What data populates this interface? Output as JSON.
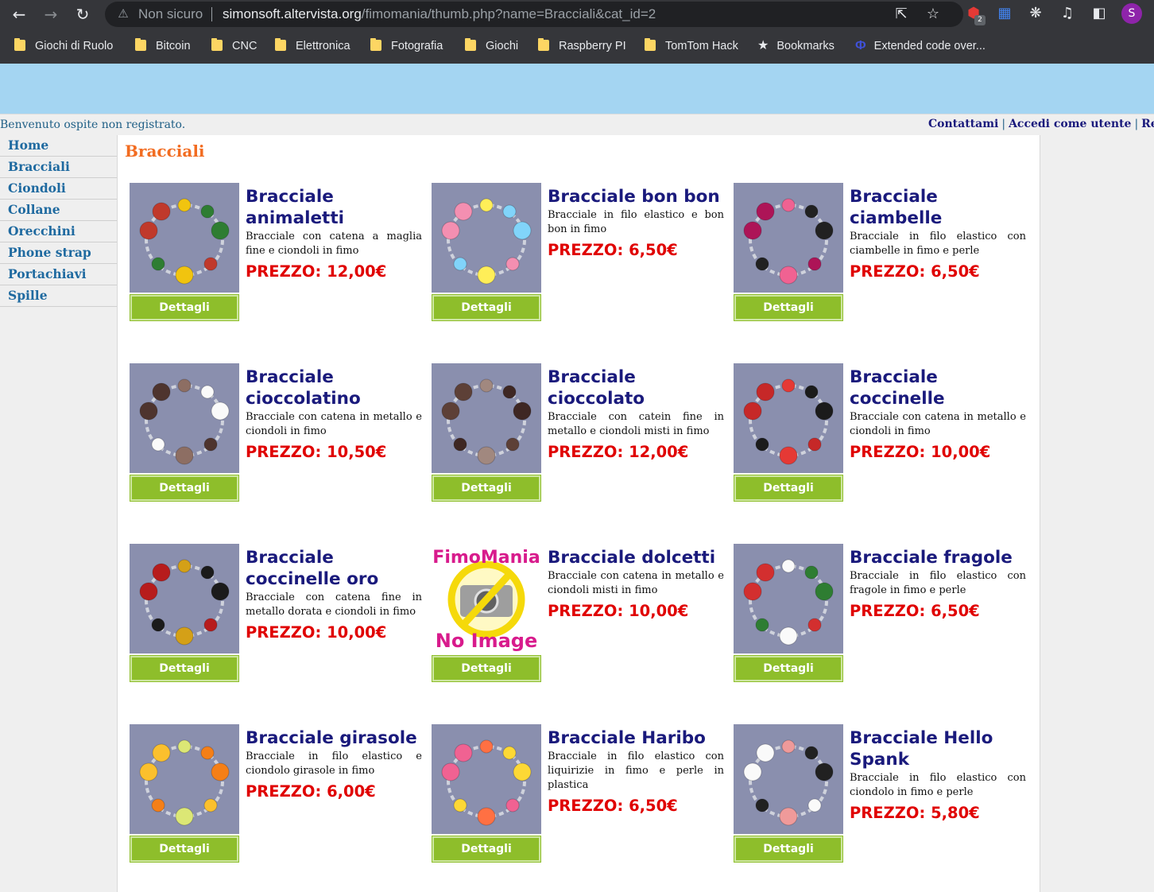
{
  "browser": {
    "security_label": "Non sicuro",
    "url_host": "simonsoft.altervista.org",
    "url_path": "/fimomania/thumb.php?name=Bracciali&cat_id=2",
    "extension_badge": "2",
    "profile_initial": "S",
    "bookmarks": [
      {
        "label": "Giochi di Ruolo",
        "icon": "folder-icon"
      },
      {
        "label": "Bitcoin",
        "icon": "folder-icon"
      },
      {
        "label": "CNC",
        "icon": "folder-icon"
      },
      {
        "label": "Elettronica",
        "icon": "folder-icon"
      },
      {
        "label": "Fotografia",
        "icon": "folder-icon"
      },
      {
        "label": "Giochi",
        "icon": "folder-icon"
      },
      {
        "label": "Raspberry PI",
        "icon": "folder-icon"
      },
      {
        "label": "TomTom Hack",
        "icon": "folder-icon"
      },
      {
        "label": "Bookmarks",
        "icon": "star-icon"
      },
      {
        "label": "Extended code over...",
        "icon": "extension-icon"
      }
    ]
  },
  "header": {
    "welcome": "Benvenuto ospite non registrato.",
    "links": [
      "Contattami",
      "Accedi come utente",
      "Registra"
    ]
  },
  "sidebar": {
    "items": [
      "Home",
      "Bracciali",
      "Ciondoli",
      "Collane",
      "Orecchini",
      "Phone strap",
      "Portachiavi",
      "Spille"
    ]
  },
  "main": {
    "category_title": "Bracciali",
    "detail_label": "Dettagli",
    "products": [
      {
        "name": "Bracciale animaletti",
        "desc": "Bracciale con catena a maglia fine e ciondoli in fimo",
        "price": "PREZZO: 12,00€"
      },
      {
        "name": "Bracciale bon bon",
        "desc": "Bracciale in filo elastico e bon bon in fimo",
        "price": "PREZZO: 6,50€"
      },
      {
        "name": "Bracciale ciambelle",
        "desc": "Bracciale in filo elastico con ciambelle in fimo e perle",
        "price": "PREZZO: 6,50€"
      },
      {
        "name": "Bracciale cioccolatino",
        "desc": "Bracciale con catena in metallo e ciondoli in fimo",
        "price": "PREZZO: 10,50€"
      },
      {
        "name": "Bracciale cioccolato",
        "desc": "Bracciale con catein fine in metallo e ciondoli misti in fimo",
        "price": "PREZZO: 12,00€"
      },
      {
        "name": "Bracciale coccinelle",
        "desc": "Bracciale con catena in metallo e ciondoli in fimo",
        "price": "PREZZO: 10,00€"
      },
      {
        "name": "Bracciale coccinelle oro",
        "desc": "Bracciale con catena fine in metallo dorata e ciondoli in fimo",
        "price": "PREZZO: 10,00€"
      },
      {
        "name": "Bracciale dolcetti",
        "desc": "Bracciale con catena in metallo e ciondoli misti in fimo",
        "price": "PREZZO: 10,00€",
        "no_image": true,
        "no_image_top": "FimoMania",
        "no_image_bottom": "No Image"
      },
      {
        "name": "Bracciale fragole",
        "desc": "Bracciale in filo elastico con fragole in fimo e perle",
        "price": "PREZZO: 6,50€"
      },
      {
        "name": "Bracciale girasole",
        "desc": "Bracciale in filo elastico e ciondolo girasole in fimo",
        "price": "PREZZO: 6,00€"
      },
      {
        "name": "Bracciale Haribo",
        "desc": "Bracciale in filo elastico con liquirizie in fimo e perle in plastica",
        "price": "PREZZO: 6,50€"
      },
      {
        "name": "Bracciale Hello Spank",
        "desc": "Bracciale in filo elastico con ciondolo in fimo e perle",
        "price": "PREZZO: 5,80€"
      }
    ]
  }
}
